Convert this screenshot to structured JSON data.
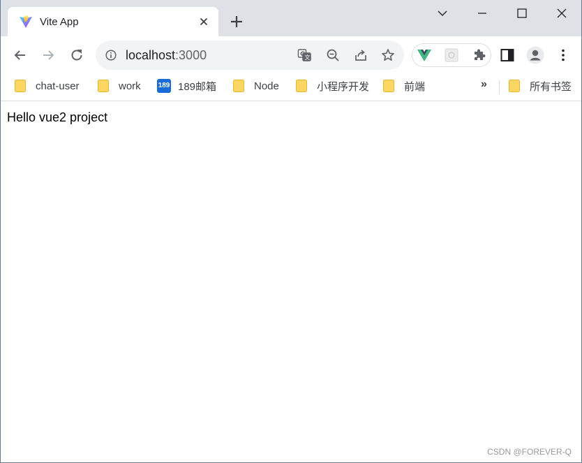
{
  "tab": {
    "title": "Vite App",
    "favicon": "vite-logo-icon",
    "close_icon": "close-icon"
  },
  "window_controls": [
    "chevron-down-icon",
    "minimize-icon",
    "maximize-icon",
    "close-icon"
  ],
  "toolbar": {
    "back_icon": "arrow-left-icon",
    "forward_icon": "arrow-right-icon",
    "reload_icon": "reload-icon",
    "url_host": "localhost",
    "url_port": ":3000",
    "omnibox_icons": [
      "translate-icon",
      "zoom-out-icon",
      "share-icon",
      "star-icon"
    ],
    "extensions": [
      "vue-devtools-icon",
      "extension-placeholder-icon",
      "puzzle-icon"
    ],
    "side_panel_icon": "side-panel-icon",
    "profile_icon": "profile-avatar-icon",
    "menu_icon": "kebab-menu-icon"
  },
  "bookmarks": {
    "items": [
      {
        "label": "chat-user",
        "icon": "folder-icon"
      },
      {
        "label": "work",
        "icon": "folder-icon"
      },
      {
        "label": "189邮箱",
        "icon": "189-mail-icon",
        "badge": "189"
      },
      {
        "label": "Node",
        "icon": "folder-icon"
      },
      {
        "label": "小程序开发",
        "icon": "folder-icon"
      },
      {
        "label": "前端",
        "icon": "folder-icon"
      }
    ],
    "more": "»",
    "all_bookmarks": "所有书签"
  },
  "page": {
    "text": "Hello vue2 project"
  },
  "watermark": "CSDN @FOREVER-Q",
  "colors": {
    "tabstrip": "#dee1e6",
    "omnibox": "#f1f3f4",
    "folder": "#fcd663",
    "badge_189": "#1a6bd6"
  }
}
